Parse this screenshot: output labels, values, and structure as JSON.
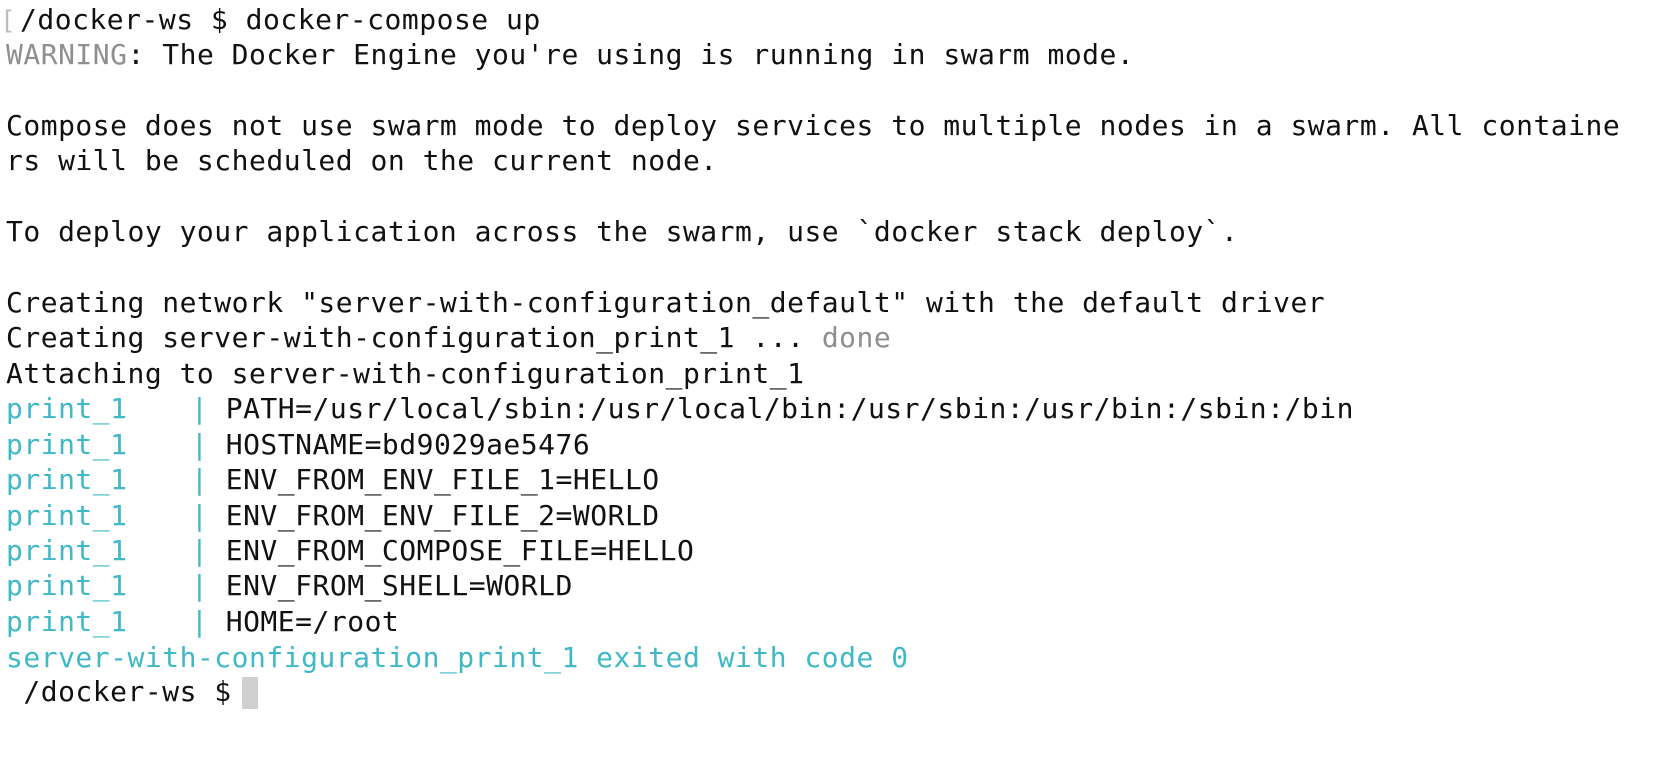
{
  "terminal": {
    "prompt_path": "/docker-ws $ ",
    "command": "docker-compose up",
    "warning": {
      "label": "WARNING",
      "text": ": The Docker Engine you're using is running in swarm mode."
    },
    "compose_line_1": "Compose does not use swarm mode to deploy services to multiple nodes in a swarm. All containe",
    "compose_line_2": "rs will be scheduled on the current node.",
    "deploy_line": "To deploy your application across the swarm, use `docker stack deploy`.",
    "creating_network": "Creating network \"server-with-configuration_default\" with the default driver",
    "creating_container": "Creating server-with-configuration_print_1 ... ",
    "creating_container_status": "done",
    "attaching": "Attaching to server-with-configuration_print_1",
    "log_lines": [
      {
        "service": "print_1",
        "separator": "|",
        "text": " PATH=/usr/local/sbin:/usr/local/bin:/usr/sbin:/usr/bin:/sbin:/bin"
      },
      {
        "service": "print_1",
        "separator": "|",
        "text": " HOSTNAME=bd9029ae5476"
      },
      {
        "service": "print_1",
        "separator": "|",
        "text": " ENV_FROM_ENV_FILE_1=HELLO"
      },
      {
        "service": "print_1",
        "separator": "|",
        "text": " ENV_FROM_ENV_FILE_2=WORLD"
      },
      {
        "service": "print_1",
        "separator": "|",
        "text": " ENV_FROM_COMPOSE_FILE=HELLO"
      },
      {
        "service": "print_1",
        "separator": "|",
        "text": " ENV_FROM_SHELL=WORLD"
      },
      {
        "service": "print_1",
        "separator": "|",
        "text": " HOME=/root"
      }
    ],
    "exit_line": "server-with-configuration_print_1 exited with code 0",
    "final_prompt": " /docker-ws $ "
  },
  "colors": {
    "background": "#ffffff",
    "text": "#111111",
    "muted": "#8f8f8f",
    "service_cyan": "#3fb8c8",
    "cursor": "#cfcfcf"
  }
}
